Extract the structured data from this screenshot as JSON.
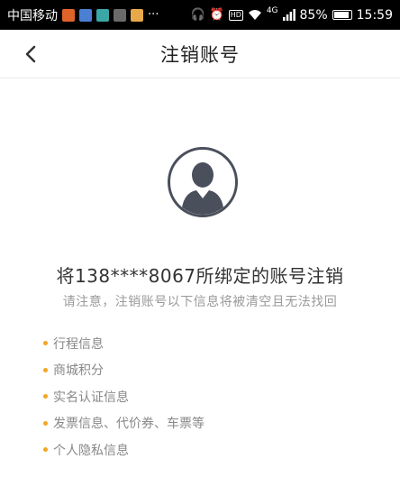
{
  "status_bar": {
    "carrier": "中国移动",
    "network": "4G",
    "battery": "85%",
    "time": "15:59",
    "ellipsis": "···"
  },
  "header": {
    "title": "注销账号",
    "back_icon": "chevron-left-icon"
  },
  "main": {
    "avatar_icon": "user-avatar-icon",
    "title": "将138****8067所绑定的账号注销",
    "subtitle": "请注意，注销账号以下信息将被清空且无法找回",
    "bullet_color": "#f5a623",
    "items": [
      {
        "label": "行程信息"
      },
      {
        "label": "商城积分"
      },
      {
        "label": "实名认证信息"
      },
      {
        "label": "发票信息、代价券、车票等"
      },
      {
        "label": "个人隐私信息"
      }
    ]
  }
}
